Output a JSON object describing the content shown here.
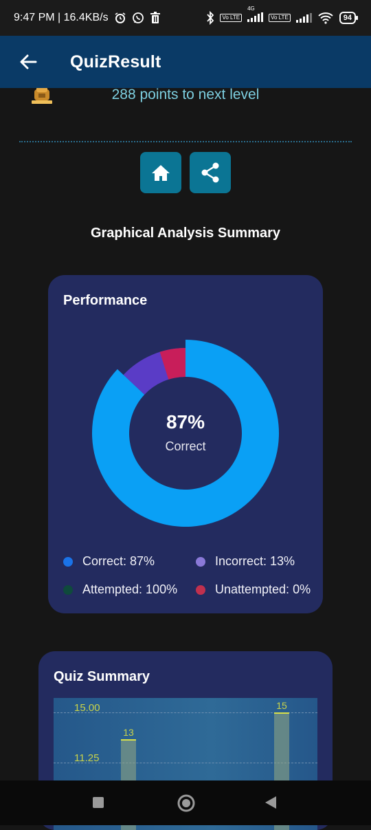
{
  "status_bar": {
    "time_speed": "9:47 PM | 16.4KB/s",
    "network": "4G",
    "volte_1": "Vo LTE",
    "volte_2": "Vo LTE",
    "battery": "94",
    "icons": [
      "alarm-icon",
      "whatsapp-icon",
      "trash-icon",
      "bluetooth-icon",
      "signal-icon",
      "wifi-icon",
      "battery-icon"
    ]
  },
  "app_bar": {
    "title": "QuizResult",
    "back_icon": "arrow-left-icon",
    "background": "#0a3a66"
  },
  "points": {
    "text": "288 points to next level",
    "icon": "trophy-icon"
  },
  "actions": {
    "home_icon": "home-icon",
    "share_icon": "share-icon",
    "color": "#0b7594"
  },
  "section_title": "Graphical Analysis Summary",
  "performance": {
    "title": "Performance",
    "center_value": "87%",
    "center_label": "Correct",
    "legend": [
      {
        "label": "Correct: 87%",
        "color": "#1a73e8"
      },
      {
        "label": "Incorrect: 13%",
        "color": "#8a79d8"
      },
      {
        "label": "Attempted: 100%",
        "color": "#0f4a3c"
      },
      {
        "label": "Unattempted: 0%",
        "color": "#c0304e"
      }
    ]
  },
  "chart_data": [
    {
      "type": "pie",
      "title": "Performance",
      "segments": [
        {
          "name": "Correct",
          "value": 87,
          "color": "#0aa0f5"
        },
        {
          "name": "Incorrect",
          "value": 13,
          "color": "#5a3cc6"
        },
        {
          "name": "Attempted",
          "value": 100,
          "color": "#0f4a3c"
        },
        {
          "name": "Unattempted",
          "value": 0,
          "color": "#c81e5a"
        }
      ],
      "center_text": "87%"
    },
    {
      "type": "bar",
      "title": "Quiz Summary",
      "values": [
        13,
        15
      ],
      "ytick_labels": [
        "15.00",
        "11.25"
      ],
      "ylim": [
        0,
        15
      ],
      "grid": true
    }
  ],
  "quiz_summary": {
    "title": "Quiz Summary",
    "ticks": [
      "15.00",
      "11.25"
    ],
    "bar_labels": [
      "13",
      "15"
    ]
  },
  "nav": {
    "icons": [
      "recent-apps-icon",
      "home-circle-icon",
      "back-triangle-icon"
    ]
  }
}
